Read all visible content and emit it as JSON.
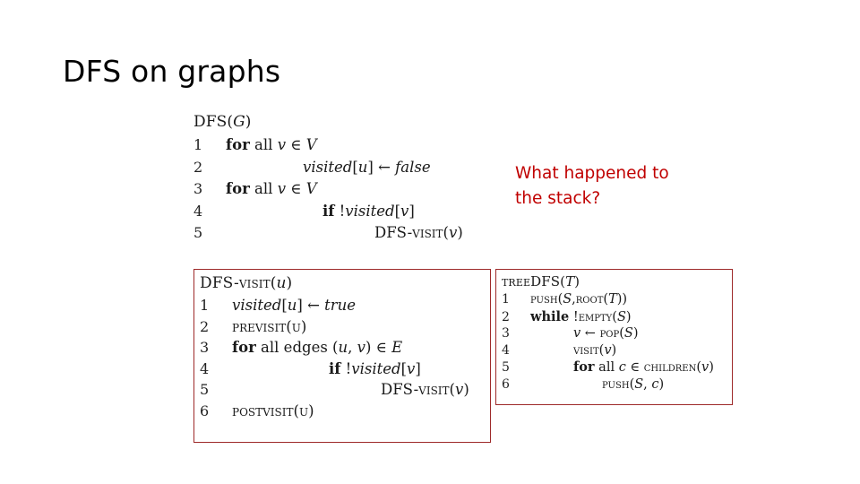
{
  "slide": {
    "title": "DFS on graphs",
    "background_color": "#FFFFFF"
  },
  "annotation": {
    "name": "stack-question",
    "color": "#C00000",
    "lines": [
      "What happened to",
      "the stack?"
    ],
    "full_text": "What happened to the stack?"
  },
  "colors": {
    "box_border": "#9E2A2A",
    "annotation_red": "#C00000",
    "text": "#1A1A1A"
  },
  "code_blocks": [
    {
      "id": "dfs",
      "name": "dfs-pseudocode",
      "boxed": false,
      "header": "DFS(G)",
      "header_parts": [
        {
          "t": "DFS(",
          "s": "rm"
        },
        {
          "t": "G",
          "s": "mi"
        },
        {
          "t": ")",
          "s": "rm"
        }
      ],
      "lines": [
        {
          "n": "1",
          "indent": 1,
          "text": "for all v ∈ V",
          "parts": [
            {
              "t": "for",
              "s": "kw"
            },
            {
              "t": " all ",
              "s": "rm"
            },
            {
              "t": "v",
              "s": "mi"
            },
            {
              "t": " ∈ ",
              "s": "op"
            },
            {
              "t": "V",
              "s": "mi"
            }
          ]
        },
        {
          "n": "2",
          "indent": 2,
          "text": "visited[u] ← false",
          "parts": [
            {
              "t": "visited",
              "s": "mi"
            },
            {
              "t": "[",
              "s": "rm"
            },
            {
              "t": "u",
              "s": "mi"
            },
            {
              "t": "]",
              "s": "rm"
            },
            {
              "t": " ← ",
              "s": "op"
            },
            {
              "t": "false",
              "s": "mi"
            }
          ]
        },
        {
          "n": "3",
          "indent": 1,
          "text": "for all v ∈ V",
          "parts": [
            {
              "t": "for",
              "s": "kw"
            },
            {
              "t": " all ",
              "s": "rm"
            },
            {
              "t": "v",
              "s": "mi"
            },
            {
              "t": " ∈ ",
              "s": "op"
            },
            {
              "t": "V",
              "s": "mi"
            }
          ]
        },
        {
          "n": "4",
          "indent": 3,
          "text": "if !visited[v]",
          "parts": [
            {
              "t": "if",
              "s": "kw"
            },
            {
              "t": " !",
              "s": "rm"
            },
            {
              "t": "visited",
              "s": "mi"
            },
            {
              "t": "[",
              "s": "rm"
            },
            {
              "t": "v",
              "s": "mi"
            },
            {
              "t": "]",
              "s": "rm"
            }
          ]
        },
        {
          "n": "5",
          "indent": 4,
          "text": "DFS-Visit(v)",
          "parts": [
            {
              "t": "DFS-",
              "s": "rm"
            },
            {
              "t": "Visit",
              "s": "sc"
            },
            {
              "t": "(",
              "s": "rm"
            },
            {
              "t": "v",
              "s": "mi"
            },
            {
              "t": ")",
              "s": "rm"
            }
          ]
        }
      ]
    },
    {
      "id": "dfsvisit",
      "name": "dfs-visit-pseudocode",
      "boxed": true,
      "header": "DFS-Visit(u)",
      "header_parts": [
        {
          "t": "DFS-",
          "s": "rm"
        },
        {
          "t": "Visit",
          "s": "sc"
        },
        {
          "t": "(",
          "s": "rm"
        },
        {
          "t": "u",
          "s": "mi"
        },
        {
          "t": ")",
          "s": "rm"
        }
      ],
      "lines": [
        {
          "n": "1",
          "indent": 1,
          "text": "visited[u] ← true",
          "parts": [
            {
              "t": "visited",
              "s": "mi"
            },
            {
              "t": "[",
              "s": "rm"
            },
            {
              "t": "u",
              "s": "mi"
            },
            {
              "t": "]",
              "s": "rm"
            },
            {
              "t": " ← ",
              "s": "op"
            },
            {
              "t": "true",
              "s": "mi"
            }
          ]
        },
        {
          "n": "2",
          "indent": 1,
          "text": "PreVisit(u)",
          "parts": [
            {
              "t": "PreVisit",
              "s": "sc"
            },
            {
              "t": "(",
              "s": "rm"
            },
            {
              "t": "u",
              "s": "sc"
            },
            {
              "t": ")",
              "s": "rm"
            }
          ]
        },
        {
          "n": "3",
          "indent": 1,
          "text": "for all edges (u, v) ∈ E",
          "parts": [
            {
              "t": "for",
              "s": "kw"
            },
            {
              "t": " all edges (",
              "s": "rm"
            },
            {
              "t": "u",
              "s": "mi"
            },
            {
              "t": ", ",
              "s": "rm"
            },
            {
              "t": "v",
              "s": "mi"
            },
            {
              "t": ") ∈ ",
              "s": "op"
            },
            {
              "t": "E",
              "s": "mi"
            }
          ]
        },
        {
          "n": "4",
          "indent": 3,
          "text": "if !visited[v]",
          "parts": [
            {
              "t": "if",
              "s": "kw"
            },
            {
              "t": " !",
              "s": "rm"
            },
            {
              "t": "visited",
              "s": "mi"
            },
            {
              "t": "[",
              "s": "rm"
            },
            {
              "t": "v",
              "s": "mi"
            },
            {
              "t": "]",
              "s": "rm"
            }
          ]
        },
        {
          "n": "5",
          "indent": 4,
          "text": "DFS-Visit(v)",
          "parts": [
            {
              "t": "DFS-",
              "s": "rm"
            },
            {
              "t": "Visit",
              "s": "sc"
            },
            {
              "t": "(",
              "s": "rm"
            },
            {
              "t": "v",
              "s": "mi"
            },
            {
              "t": ")",
              "s": "rm"
            }
          ]
        },
        {
          "n": "6",
          "indent": 1,
          "text": "PostVisit(u)",
          "parts": [
            {
              "t": "PostVisit",
              "s": "sc"
            },
            {
              "t": "(",
              "s": "rm"
            },
            {
              "t": "u",
              "s": "sc"
            },
            {
              "t": ")",
              "s": "rm"
            }
          ]
        }
      ]
    },
    {
      "id": "treedfs",
      "name": "tree-dfs-pseudocode",
      "boxed": true,
      "header": "TreeDFS(T)",
      "header_parts": [
        {
          "t": "Tree",
          "s": "sc"
        },
        {
          "t": "DFS(",
          "s": "rm"
        },
        {
          "t": "T",
          "s": "mi"
        },
        {
          "t": ")",
          "s": "rm"
        }
      ],
      "lines": [
        {
          "n": "1",
          "indent": 1,
          "text": "Push(S, Root(T))",
          "parts": [
            {
              "t": "Push",
              "s": "sc"
            },
            {
              "t": "(",
              "s": "rm"
            },
            {
              "t": "S",
              "s": "mi"
            },
            {
              "t": ",",
              "s": "rm"
            },
            {
              "t": "Root",
              "s": "sc"
            },
            {
              "t": "(",
              "s": "rm"
            },
            {
              "t": "T",
              "s": "mi"
            },
            {
              "t": "))",
              "s": "rm"
            }
          ]
        },
        {
          "n": "2",
          "indent": 1,
          "text": "while !Empty(S)",
          "parts": [
            {
              "t": "while",
              "s": "kw"
            },
            {
              "t": " !",
              "s": "rm"
            },
            {
              "t": "Empty",
              "s": "sc"
            },
            {
              "t": "(",
              "s": "rm"
            },
            {
              "t": "S",
              "s": "mi"
            },
            {
              "t": ")",
              "s": "rm"
            }
          ]
        },
        {
          "n": "3",
          "indent": 2,
          "text": "v ← Pop(S)",
          "parts": [
            {
              "t": "v",
              "s": "mi"
            },
            {
              "t": " ← ",
              "s": "op"
            },
            {
              "t": "Pop",
              "s": "sc"
            },
            {
              "t": "(",
              "s": "rm"
            },
            {
              "t": "S",
              "s": "mi"
            },
            {
              "t": ")",
              "s": "rm"
            }
          ]
        },
        {
          "n": "4",
          "indent": 2,
          "text": "Visit(v)",
          "parts": [
            {
              "t": "Visit",
              "s": "sc"
            },
            {
              "t": "(",
              "s": "rm"
            },
            {
              "t": "v",
              "s": "mi"
            },
            {
              "t": ")",
              "s": "rm"
            }
          ]
        },
        {
          "n": "5",
          "indent": 2,
          "text": "for all c ∈ Children(v)",
          "parts": [
            {
              "t": "for",
              "s": "kw"
            },
            {
              "t": " all ",
              "s": "rm"
            },
            {
              "t": "c",
              "s": "mi"
            },
            {
              "t": " ∈ ",
              "s": "op"
            },
            {
              "t": "Children",
              "s": "sc"
            },
            {
              "t": "(",
              "s": "rm"
            },
            {
              "t": "v",
              "s": "mi"
            },
            {
              "t": ")",
              "s": "rm"
            }
          ]
        },
        {
          "n": "6",
          "indent": 4,
          "text": "Push(S, c)",
          "parts": [
            {
              "t": "Push",
              "s": "sc"
            },
            {
              "t": "(",
              "s": "rm"
            },
            {
              "t": "S",
              "s": "mi"
            },
            {
              "t": ", ",
              "s": "rm"
            },
            {
              "t": "c",
              "s": "mi"
            },
            {
              "t": ")",
              "s": "rm"
            }
          ]
        }
      ]
    }
  ]
}
